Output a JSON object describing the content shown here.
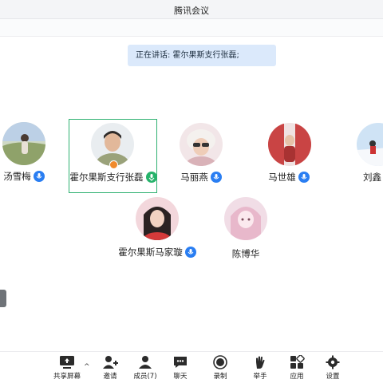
{
  "window": {
    "title": "腾讯会议"
  },
  "speaking_banner": "正在讲话: 霍尔果斯支行张磊;",
  "participants": [
    {
      "name": "汤雪梅",
      "mic": "blue"
    },
    {
      "name": "霍尔果斯支行张磊",
      "mic": "green",
      "active": true,
      "host": true
    },
    {
      "name": "马丽燕",
      "mic": "blue"
    },
    {
      "name": "马世雄",
      "mic": "blue"
    },
    {
      "name": "刘鑫",
      "mic": "blue"
    },
    {
      "name": "霍尔果斯马家璇",
      "mic": "blue"
    },
    {
      "name": "陈博华",
      "mic": "none"
    }
  ],
  "toolbar": {
    "share": "共享屏幕",
    "invite": "邀请",
    "members": "成员(7)",
    "chat": "聊天",
    "record": "录制",
    "raise_hand": "举手",
    "apps": "应用",
    "settings": "设置"
  },
  "colors": {
    "accent_blue": "#2a7ef2",
    "active_green": "#2fb171",
    "banner_bg": "#dbe9fb"
  }
}
